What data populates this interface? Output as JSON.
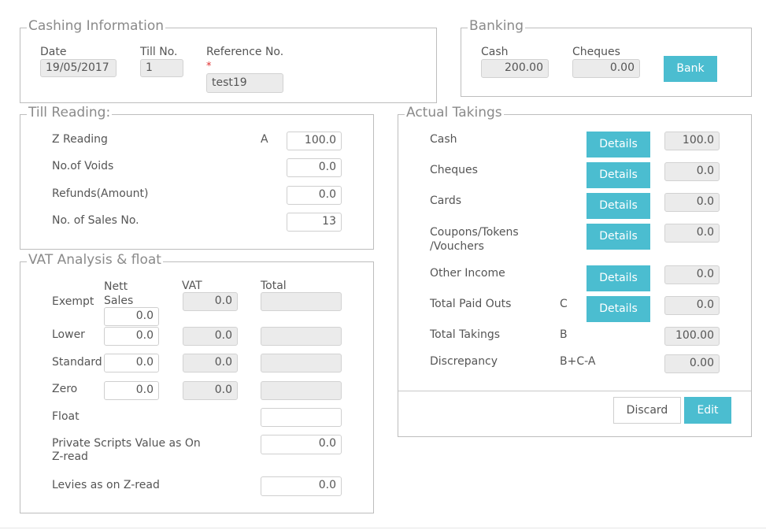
{
  "cashing": {
    "title": "Cashing Information",
    "date_label": "Date",
    "date_value": "19/05/2017",
    "till_label": "Till No.",
    "till_value": "1",
    "ref_label": "Reference No.",
    "ref_required": "*",
    "ref_value": "test19"
  },
  "banking": {
    "title": "Banking",
    "cash_label": "Cash",
    "cash_value": "200.00",
    "cheques_label": "Cheques",
    "cheques_value": "0.00",
    "bank_button": "Bank"
  },
  "till_reading": {
    "title": "Till Reading:",
    "rows": [
      {
        "label": "Z Reading",
        "marker": "A",
        "value": "100.0"
      },
      {
        "label": "No.of Voids",
        "marker": "",
        "value": "0.0"
      },
      {
        "label": "Refunds(Amount)",
        "marker": "",
        "value": "0.0"
      },
      {
        "label": "No. of Sales No.",
        "marker": "",
        "value": "13"
      }
    ]
  },
  "vat": {
    "title": "VAT Analysis & float",
    "col_nett": "Nett Sales",
    "col_vat": "VAT",
    "col_total": "Total",
    "rows": [
      {
        "label": "Exempt",
        "nett": "0.0",
        "vat": "0.0",
        "total": ""
      },
      {
        "label": "Lower",
        "nett": "0.0",
        "vat": "0.0",
        "total": ""
      },
      {
        "label": "Standard",
        "nett": "0.0",
        "vat": "0.0",
        "total": ""
      },
      {
        "label": "Zero",
        "nett": "0.0",
        "vat": "0.0",
        "total": ""
      }
    ],
    "float_label": "Float",
    "float_value": "",
    "private_label": "Private Scripts Value as On Z-read",
    "private_value": "0.0",
    "levies_label": "Levies as on Z-read",
    "levies_value": "0.0"
  },
  "actual": {
    "title": "Actual Takings",
    "details_label": "Details",
    "rows": [
      {
        "label": "Cash",
        "marker": "",
        "value": "100.0"
      },
      {
        "label": "Cheques",
        "marker": "",
        "value": "0.0"
      },
      {
        "label": "Cards",
        "marker": "",
        "value": "0.0"
      },
      {
        "label": "Coupons/Tokens /Vouchers",
        "marker": "",
        "value": "0.0"
      },
      {
        "label": "Other Income",
        "marker": "",
        "value": "0.0"
      },
      {
        "label": "Total Paid Outs",
        "marker": "C",
        "value": "0.0"
      }
    ],
    "total_label": "Total Takings",
    "total_marker": "B",
    "total_value": "100.00",
    "disc_label": "Discrepancy",
    "disc_marker": "B+C-A",
    "disc_value": "0.00",
    "discard_button": "Discard",
    "edit_button": "Edit"
  },
  "colors": {
    "accent": "#4bbdd0",
    "readonly_bg": "#ebebeb",
    "border": "#bdbdbd"
  }
}
